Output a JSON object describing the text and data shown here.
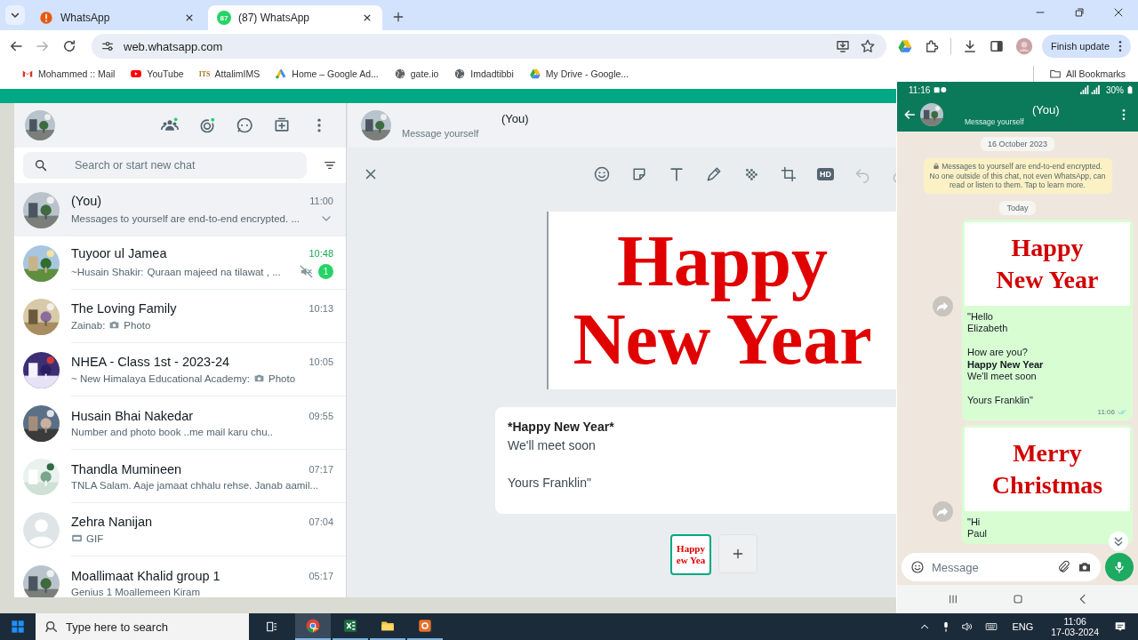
{
  "browser": {
    "tabs": [
      {
        "title": "WhatsApp",
        "selected": false,
        "kind": "alert"
      },
      {
        "title": "(87) WhatsApp",
        "selected": true,
        "kind": "badge",
        "badge": "87"
      }
    ],
    "url": "web.whatsapp.com",
    "update_button": "Finish update",
    "bookmarks": [
      {
        "label": "Mohammed :: Mail",
        "kind": "mail"
      },
      {
        "label": "YouTube",
        "kind": "video"
      },
      {
        "label": "AttalimIMS",
        "kind": "text",
        "icon_text": "ITS"
      },
      {
        "label": "Home – Google Ad...",
        "kind": "ads"
      },
      {
        "label": "gate.io",
        "kind": "globe"
      },
      {
        "label": "Imdadtibbi",
        "kind": "globe"
      },
      {
        "label": "My Drive - Google...",
        "kind": "drive"
      }
    ],
    "all_bookmarks": "All Bookmarks"
  },
  "whatsapp": {
    "search": {
      "placeholder": "Search or start new chat"
    },
    "chats": [
      {
        "name": "(You)",
        "time": "11:00",
        "preview": "Messages to yourself are end-to-end encrypted. ...",
        "selected": true,
        "muted": false
      },
      {
        "name": "Tuyoor ul Jamea",
        "time": "10:48",
        "sender": "~Husain Shakir:",
        "preview": "Quraan majeed na tilawat , ...",
        "selected": false,
        "muted": true,
        "unread": "1"
      },
      {
        "name": "The Loving Family",
        "time": "10:13",
        "sender": "Zainab:",
        "preview": "Photo",
        "selected": false,
        "muted": false
      },
      {
        "name": "NHEA - Class 1st - 2023-24",
        "time": "10:05",
        "sender": "~ New Himalaya Educational Academy:",
        "preview": "Photo",
        "selected": false,
        "muted": false
      },
      {
        "name": "Husain Bhai Nakedar",
        "time": "09:55",
        "preview": "Number and photo book ..me mail karu chu..",
        "selected": false,
        "muted": false
      },
      {
        "name": "Thandla Mumineen",
        "time": "07:17",
        "preview": "TNLA Salam. Aaje jamaat chhalu rehse. Janab aamil...",
        "selected": false,
        "muted": false
      },
      {
        "name": "Zehra Nanijan",
        "time": "07:04",
        "attachment": {
          "kind": "gif"
        },
        "preview": "GIF",
        "selected": false,
        "muted": false,
        "avatar": {
          "kind": "default"
        }
      },
      {
        "name": "Moallimaat Khalid group 1",
        "time": "05:17",
        "preview": "Genius 1 Moallemeen Kiram",
        "selected": false,
        "muted": false
      }
    ],
    "chat_header": {
      "name": "(You)",
      "subtitle": "Message yourself"
    },
    "tools": [
      {
        "kind": "emoji",
        "disabled": false
      },
      {
        "kind": "sticker",
        "disabled": false
      },
      {
        "kind": "text",
        "disabled": false
      },
      {
        "kind": "pen",
        "disabled": false
      },
      {
        "kind": "blur",
        "disabled": false
      },
      {
        "kind": "crop",
        "disabled": false
      },
      {
        "kind": "hd",
        "label": "HD",
        "disabled": false
      },
      {
        "kind": "undo",
        "disabled": true
      },
      {
        "kind": "redo",
        "disabled": true
      }
    ],
    "preview_card": [
      "Happy",
      "New Year"
    ],
    "caption": [
      {
        "text": "*Happy New Year*",
        "bold": true,
        "gap": false
      },
      {
        "text": "We'll meet soon",
        "bold": false,
        "gap": false
      },
      {
        "text": "Yours Franklin\"",
        "bold": false,
        "gap": true
      }
    ],
    "thumbnails": [
      {
        "lines": [
          "Happy",
          "ew Yea"
        ],
        "selected": true
      }
    ]
  },
  "phone": {
    "status_time": "11:16",
    "battery": "30%",
    "title": "(You)",
    "subtitle": "Message yourself",
    "date_chip": "16 October 2023",
    "notice": "Messages to yourself are end-to-end encrypted. No one outside of this chat, not even WhatsApp, can read or listen to them. Tap to learn more.",
    "today_chip": "Today",
    "messages": [
      {
        "card": [
          "Happy",
          "New Year"
        ],
        "lines": [
          {
            "text": "\"Hello",
            "bold": false,
            "gap": false
          },
          {
            "text": "Elizabeth",
            "bold": false,
            "gap": false
          },
          {
            "text": "How are you?",
            "bold": false,
            "gap": true
          },
          {
            "text": "Happy New Year",
            "bold": true,
            "gap": false
          },
          {
            "text": "We'll meet soon",
            "bold": false,
            "gap": false
          },
          {
            "text": "Yours Franklin\"",
            "bold": false,
            "gap": true
          }
        ],
        "time": "11:06",
        "read": true
      },
      {
        "card": [
          "Merry",
          "Christmas"
        ],
        "lines": [
          {
            "text": "\"Hi",
            "bold": false,
            "gap": false
          },
          {
            "text": "Paul",
            "bold": false,
            "gap": false
          }
        ]
      }
    ],
    "composer": {
      "placeholder": "Message"
    }
  },
  "taskbar": {
    "search_placeholder": "Type here to search",
    "apps": [
      {
        "kind": "browser",
        "selected": true
      },
      {
        "kind": "sheet",
        "selected": false
      },
      {
        "kind": "folder",
        "selected": false
      },
      {
        "kind": "recorder",
        "selected": false
      }
    ],
    "language": "ENG",
    "time": "11:06",
    "date": "17-03-2024"
  }
}
